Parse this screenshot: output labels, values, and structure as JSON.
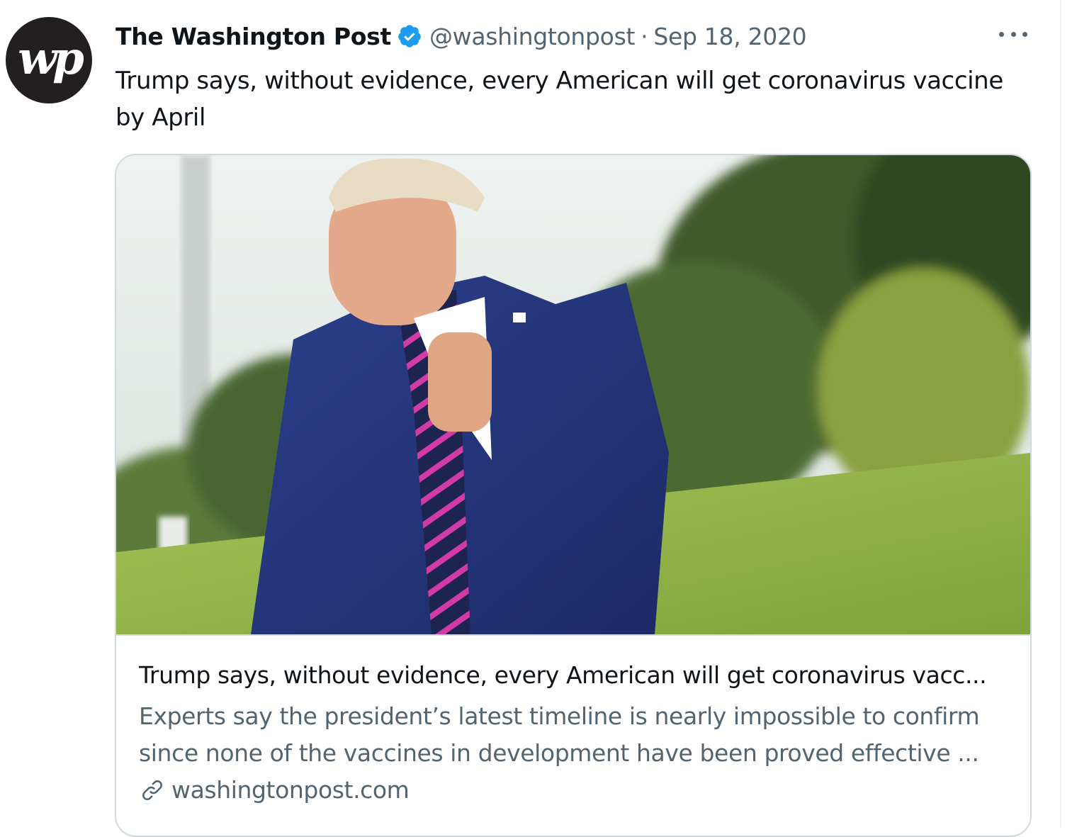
{
  "tweet": {
    "avatar_initials": "wp",
    "display_name": "The Washington Post",
    "handle": "@washingtonpost",
    "separator": "·",
    "date": "Sep 18, 2020",
    "text": "Trump says, without evidence, every American will get coronavirus vaccine by April",
    "more_icon": "more-horizontal-icon",
    "verified_icon": "verified-badge-icon"
  },
  "card": {
    "image_alt": "Trump says, without evidence, every American will get coronavirus vaccine by April",
    "title": "Trump says, without evidence, every American will get coronavirus vacc...",
    "description": "Experts say the president’s latest timeline is nearly impossible to confirm since none of the vaccines in development have been proved effective ...",
    "domain": "washingtonpost.com",
    "link_icon": "link-icon"
  },
  "colors": {
    "primary_text": "#0f1419",
    "secondary_text": "#536471",
    "border": "#cfd9de",
    "verified": "#1d9bf0"
  }
}
